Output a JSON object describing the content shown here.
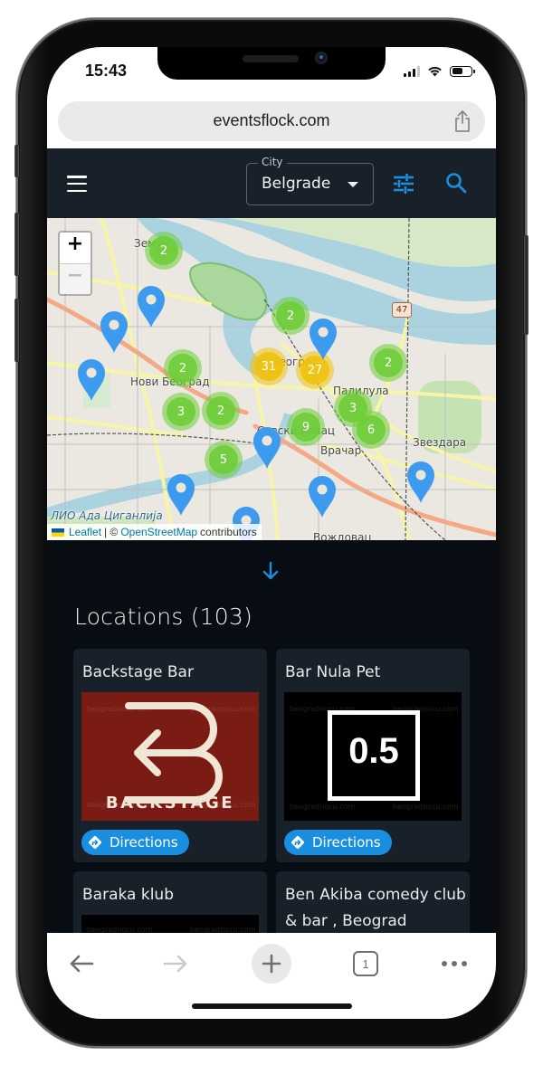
{
  "status_bar": {
    "time": "15:43",
    "battery_level": 0.55
  },
  "browser": {
    "url": "eventsflock.com",
    "toolbar": {
      "tab_count": "1"
    }
  },
  "header": {
    "city_label": "City",
    "city_value": "Belgrade"
  },
  "map": {
    "zoom_in": "+",
    "zoom_out": "−",
    "route_badge": "47",
    "labels": [
      {
        "text": "Земун"
      },
      {
        "text": "Нови Београд"
      },
      {
        "text": "Београд"
      },
      {
        "text": "Палилула"
      },
      {
        "text": "Савски венац"
      },
      {
        "text": "Врачар"
      },
      {
        "text": "Звездара"
      },
      {
        "text": "ЛИО Ада Циганлија"
      },
      {
        "text": "Вождовац"
      }
    ],
    "clusters": [
      {
        "count": "2",
        "level": "small"
      },
      {
        "count": "2",
        "level": "small"
      },
      {
        "count": "2",
        "level": "small"
      },
      {
        "count": "31",
        "level": "medium"
      },
      {
        "count": "27",
        "level": "medium"
      },
      {
        "count": "2",
        "level": "small"
      },
      {
        "count": "3",
        "level": "small"
      },
      {
        "count": "2",
        "level": "small"
      },
      {
        "count": "3",
        "level": "small"
      },
      {
        "count": "9",
        "level": "small"
      },
      {
        "count": "6",
        "level": "small"
      },
      {
        "count": "5",
        "level": "small"
      }
    ],
    "pin_count": 9,
    "attribution": {
      "leaflet": "Leaflet",
      "separator": "| ©",
      "osm": "OpenStreetMap",
      "suffix": "contributors"
    }
  },
  "locations": {
    "title": "Locations (103)",
    "directions_label": "Directions",
    "items": [
      {
        "name": "Backstage Bar",
        "image_text": "BACKSTAGE",
        "image_bg": "#7a1c14"
      },
      {
        "name": "Bar Nula Pet",
        "image_text": "0.5",
        "image_bg": "#000000"
      },
      {
        "name": "Baraka klub",
        "image_bg": "#000000"
      },
      {
        "name": "Ben Akiba comedy club & bar , Beograd",
        "image_bg": "#000000"
      }
    ],
    "watermark": "beogradnocu.com"
  },
  "colors": {
    "accent": "#1a8fe0",
    "header_bg": "#18202a",
    "page_bg": "#080d14",
    "cluster_small": "#6ecc39",
    "cluster_medium": "#f0c20c",
    "pin": "#3d9bef"
  }
}
